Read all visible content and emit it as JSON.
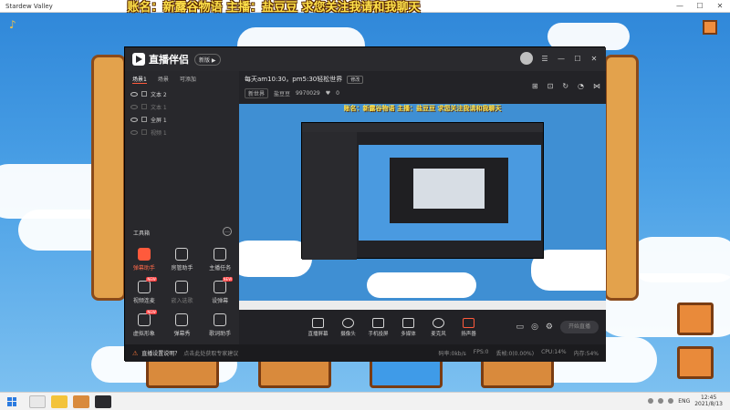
{
  "window": {
    "title": "Stardew Valley",
    "minimize": "—",
    "maximize": "☐",
    "close": "✕"
  },
  "overlay_banner": "账名：新露谷物语   主播：盐豆豆   求您关注我请和我聊天",
  "app": {
    "logo_text": "直播伴侣",
    "edition_badge": "新版 ▶",
    "scene_tabs": [
      "场景1",
      "场景",
      "可添加"
    ],
    "sources": [
      {
        "label": "文本 2",
        "dim": false
      },
      {
        "label": "文本 1",
        "dim": true
      },
      {
        "label": "全屏 1",
        "dim": false
      },
      {
        "label": "视频 1",
        "dim": true
      }
    ],
    "tools_title": "工具箱",
    "tools_more": "…",
    "tools": [
      {
        "label": "弹幕助手",
        "hot": true,
        "badge": ""
      },
      {
        "label": "房管助手",
        "hot": false,
        "badge": ""
      },
      {
        "label": "主播任务",
        "hot": false,
        "badge": ""
      },
      {
        "label": "视频连麦",
        "hot": false,
        "badge": "NEW"
      },
      {
        "label": "嵌入选歌",
        "hot": false,
        "badge": ""
      },
      {
        "label": "设弹幕",
        "hot": false,
        "badge": "NEW"
      },
      {
        "label": "虚拟形象",
        "hot": false,
        "badge": "NEW"
      },
      {
        "label": "弹幕秀",
        "hot": false,
        "badge": ""
      },
      {
        "label": "歌词助手",
        "hot": false,
        "badge": ""
      },
      {
        "label": "",
        "hot": false,
        "badge": ""
      },
      {
        "label": "",
        "hot": false,
        "badge": ""
      },
      {
        "label": "",
        "hot": false,
        "badge": ""
      }
    ],
    "room": {
      "title": "每天am10:30，pm5:30轻松世界",
      "title_btn": "修改",
      "category": "新世界",
      "streamer": "盐豆豆",
      "id": "9970029",
      "likes": "0"
    },
    "preview": {
      "banner": "账名：新露谷物语   主播：盐豆豆   求您关注我请和我聊天"
    },
    "controls": [
      {
        "label": "直播屏幕",
        "round": false,
        "red": false
      },
      {
        "label": "摄像头",
        "round": true,
        "red": false
      },
      {
        "label": "手机投屏",
        "round": false,
        "red": false
      },
      {
        "label": "多媒体",
        "round": false,
        "red": false
      },
      {
        "label": "麦克风",
        "round": true,
        "red": false
      },
      {
        "label": "扬声器",
        "round": false,
        "red": true
      }
    ],
    "start_button": "开始直播",
    "status": {
      "icon": "⚠",
      "question": "直播设置说明？",
      "link": "点击此处获取专家建议",
      "stats": [
        "码率:0kb/s",
        "FPS:0",
        "丢帧:0(0.00%)",
        "CPU:14%",
        "内存:54%"
      ]
    }
  },
  "taskbar": {
    "tray_lang": "ENG",
    "time": "12:45",
    "date": "2021/8/13"
  }
}
